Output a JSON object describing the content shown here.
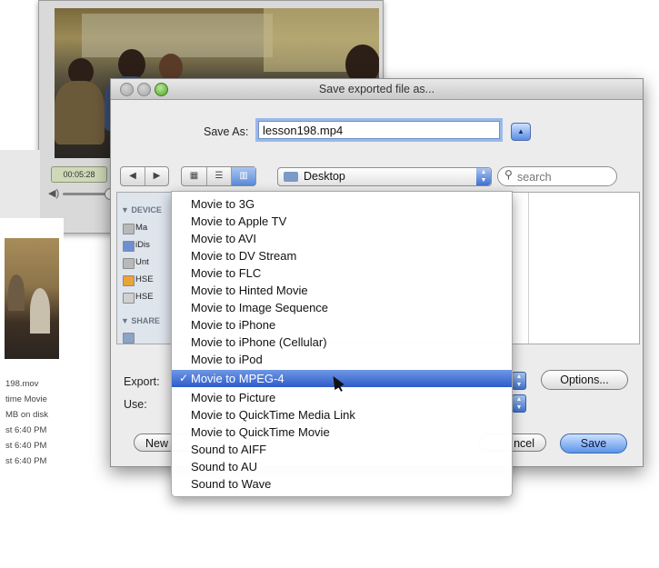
{
  "player": {
    "timecode": "00:05:28"
  },
  "info_panel": {
    "lines": [
      "198.mov",
      "time Movie",
      "MB on disk",
      "st 6:40 PM",
      "st 6:40 PM",
      "st 6:40 PM"
    ]
  },
  "dialog": {
    "title": "Save exported file as...",
    "save_as_label": "Save As:",
    "filename": "lesson198.mp4",
    "location": "Desktop",
    "search_placeholder": "search",
    "sidebar": {
      "devices_header": "DEVICE",
      "devices": [
        "Ma",
        "iDis",
        "Unt",
        "HSE",
        "HSE"
      ],
      "shared_header": "SHARE"
    },
    "export_label": "Export:",
    "use_label": "Use:",
    "options_label": "Options...",
    "new_folder_label": "New",
    "cancel_label": "ncel",
    "save_label": "Save"
  },
  "export_menu": {
    "selected_index": 10,
    "checkmark": "✓",
    "items": [
      "Movie to 3G",
      "Movie to Apple TV",
      "Movie to AVI",
      "Movie to DV Stream",
      "Movie to FLC",
      "Movie to Hinted Movie",
      "Movie to Image Sequence",
      "Movie to iPhone",
      "Movie to iPhone (Cellular)",
      "Movie to iPod",
      "Movie to MPEG-4",
      "Movie to Picture",
      "Movie to QuickTime Media Link",
      "Movie to QuickTime Movie",
      "Sound to AIFF",
      "Sound to AU",
      "Sound to Wave"
    ]
  },
  "colors": {
    "selection": "#2d5cc9",
    "focus_ring": "#9ab9ea"
  }
}
